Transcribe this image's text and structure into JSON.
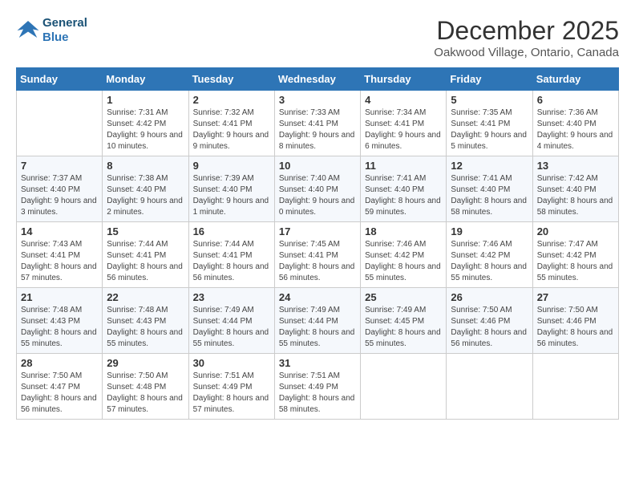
{
  "header": {
    "logo_line1": "General",
    "logo_line2": "Blue",
    "month": "December 2025",
    "location": "Oakwood Village, Ontario, Canada"
  },
  "weekdays": [
    "Sunday",
    "Monday",
    "Tuesday",
    "Wednesday",
    "Thursday",
    "Friday",
    "Saturday"
  ],
  "weeks": [
    [
      {
        "day": "",
        "sunrise": "",
        "sunset": "",
        "daylight": ""
      },
      {
        "day": "1",
        "sunrise": "Sunrise: 7:31 AM",
        "sunset": "Sunset: 4:42 PM",
        "daylight": "Daylight: 9 hours and 10 minutes."
      },
      {
        "day": "2",
        "sunrise": "Sunrise: 7:32 AM",
        "sunset": "Sunset: 4:41 PM",
        "daylight": "Daylight: 9 hours and 9 minutes."
      },
      {
        "day": "3",
        "sunrise": "Sunrise: 7:33 AM",
        "sunset": "Sunset: 4:41 PM",
        "daylight": "Daylight: 9 hours and 8 minutes."
      },
      {
        "day": "4",
        "sunrise": "Sunrise: 7:34 AM",
        "sunset": "Sunset: 4:41 PM",
        "daylight": "Daylight: 9 hours and 6 minutes."
      },
      {
        "day": "5",
        "sunrise": "Sunrise: 7:35 AM",
        "sunset": "Sunset: 4:41 PM",
        "daylight": "Daylight: 9 hours and 5 minutes."
      },
      {
        "day": "6",
        "sunrise": "Sunrise: 7:36 AM",
        "sunset": "Sunset: 4:40 PM",
        "daylight": "Daylight: 9 hours and 4 minutes."
      }
    ],
    [
      {
        "day": "7",
        "sunrise": "Sunrise: 7:37 AM",
        "sunset": "Sunset: 4:40 PM",
        "daylight": "Daylight: 9 hours and 3 minutes."
      },
      {
        "day": "8",
        "sunrise": "Sunrise: 7:38 AM",
        "sunset": "Sunset: 4:40 PM",
        "daylight": "Daylight: 9 hours and 2 minutes."
      },
      {
        "day": "9",
        "sunrise": "Sunrise: 7:39 AM",
        "sunset": "Sunset: 4:40 PM",
        "daylight": "Daylight: 9 hours and 1 minute."
      },
      {
        "day": "10",
        "sunrise": "Sunrise: 7:40 AM",
        "sunset": "Sunset: 4:40 PM",
        "daylight": "Daylight: 9 hours and 0 minutes."
      },
      {
        "day": "11",
        "sunrise": "Sunrise: 7:41 AM",
        "sunset": "Sunset: 4:40 PM",
        "daylight": "Daylight: 8 hours and 59 minutes."
      },
      {
        "day": "12",
        "sunrise": "Sunrise: 7:41 AM",
        "sunset": "Sunset: 4:40 PM",
        "daylight": "Daylight: 8 hours and 58 minutes."
      },
      {
        "day": "13",
        "sunrise": "Sunrise: 7:42 AM",
        "sunset": "Sunset: 4:40 PM",
        "daylight": "Daylight: 8 hours and 58 minutes."
      }
    ],
    [
      {
        "day": "14",
        "sunrise": "Sunrise: 7:43 AM",
        "sunset": "Sunset: 4:41 PM",
        "daylight": "Daylight: 8 hours and 57 minutes."
      },
      {
        "day": "15",
        "sunrise": "Sunrise: 7:44 AM",
        "sunset": "Sunset: 4:41 PM",
        "daylight": "Daylight: 8 hours and 56 minutes."
      },
      {
        "day": "16",
        "sunrise": "Sunrise: 7:44 AM",
        "sunset": "Sunset: 4:41 PM",
        "daylight": "Daylight: 8 hours and 56 minutes."
      },
      {
        "day": "17",
        "sunrise": "Sunrise: 7:45 AM",
        "sunset": "Sunset: 4:41 PM",
        "daylight": "Daylight: 8 hours and 56 minutes."
      },
      {
        "day": "18",
        "sunrise": "Sunrise: 7:46 AM",
        "sunset": "Sunset: 4:42 PM",
        "daylight": "Daylight: 8 hours and 55 minutes."
      },
      {
        "day": "19",
        "sunrise": "Sunrise: 7:46 AM",
        "sunset": "Sunset: 4:42 PM",
        "daylight": "Daylight: 8 hours and 55 minutes."
      },
      {
        "day": "20",
        "sunrise": "Sunrise: 7:47 AM",
        "sunset": "Sunset: 4:42 PM",
        "daylight": "Daylight: 8 hours and 55 minutes."
      }
    ],
    [
      {
        "day": "21",
        "sunrise": "Sunrise: 7:48 AM",
        "sunset": "Sunset: 4:43 PM",
        "daylight": "Daylight: 8 hours and 55 minutes."
      },
      {
        "day": "22",
        "sunrise": "Sunrise: 7:48 AM",
        "sunset": "Sunset: 4:43 PM",
        "daylight": "Daylight: 8 hours and 55 minutes."
      },
      {
        "day": "23",
        "sunrise": "Sunrise: 7:49 AM",
        "sunset": "Sunset: 4:44 PM",
        "daylight": "Daylight: 8 hours and 55 minutes."
      },
      {
        "day": "24",
        "sunrise": "Sunrise: 7:49 AM",
        "sunset": "Sunset: 4:44 PM",
        "daylight": "Daylight: 8 hours and 55 minutes."
      },
      {
        "day": "25",
        "sunrise": "Sunrise: 7:49 AM",
        "sunset": "Sunset: 4:45 PM",
        "daylight": "Daylight: 8 hours and 55 minutes."
      },
      {
        "day": "26",
        "sunrise": "Sunrise: 7:50 AM",
        "sunset": "Sunset: 4:46 PM",
        "daylight": "Daylight: 8 hours and 56 minutes."
      },
      {
        "day": "27",
        "sunrise": "Sunrise: 7:50 AM",
        "sunset": "Sunset: 4:46 PM",
        "daylight": "Daylight: 8 hours and 56 minutes."
      }
    ],
    [
      {
        "day": "28",
        "sunrise": "Sunrise: 7:50 AM",
        "sunset": "Sunset: 4:47 PM",
        "daylight": "Daylight: 8 hours and 56 minutes."
      },
      {
        "day": "29",
        "sunrise": "Sunrise: 7:50 AM",
        "sunset": "Sunset: 4:48 PM",
        "daylight": "Daylight: 8 hours and 57 minutes."
      },
      {
        "day": "30",
        "sunrise": "Sunrise: 7:51 AM",
        "sunset": "Sunset: 4:49 PM",
        "daylight": "Daylight: 8 hours and 57 minutes."
      },
      {
        "day": "31",
        "sunrise": "Sunrise: 7:51 AM",
        "sunset": "Sunset: 4:49 PM",
        "daylight": "Daylight: 8 hours and 58 minutes."
      },
      {
        "day": "",
        "sunrise": "",
        "sunset": "",
        "daylight": ""
      },
      {
        "day": "",
        "sunrise": "",
        "sunset": "",
        "daylight": ""
      },
      {
        "day": "",
        "sunrise": "",
        "sunset": "",
        "daylight": ""
      }
    ]
  ]
}
